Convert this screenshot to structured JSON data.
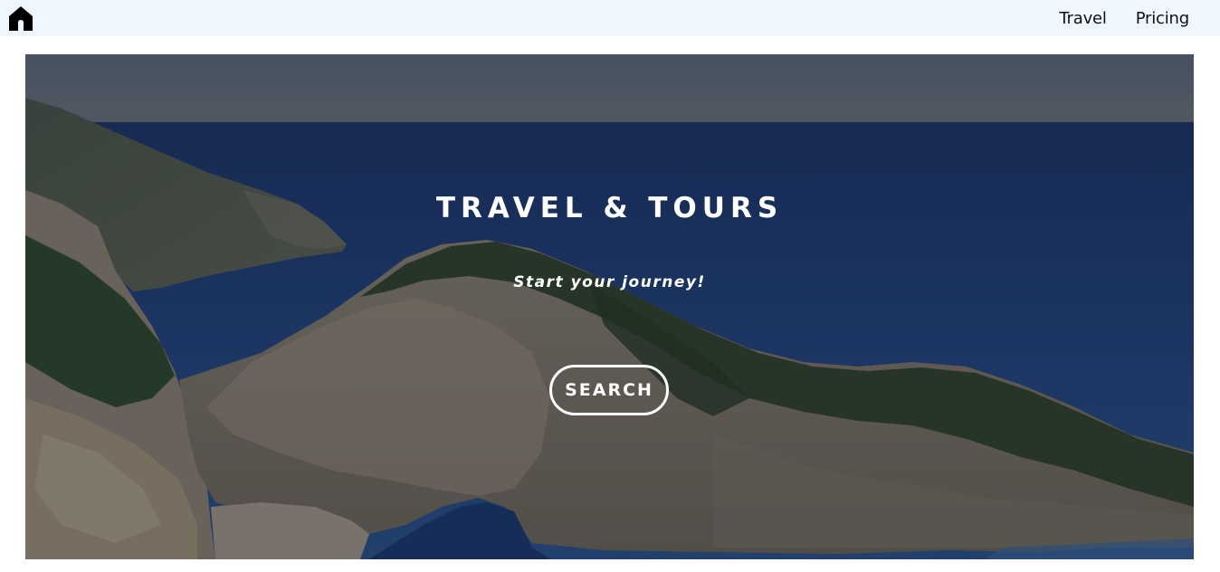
{
  "nav": {
    "home_icon": "home-icon",
    "links": [
      {
        "label": "Travel"
      },
      {
        "label": "Pricing"
      }
    ]
  },
  "hero": {
    "title": "TRAVEL & TOURS",
    "subtitle": "Start your journey!",
    "button_label": "SEARCH"
  },
  "colors": {
    "navbar_bg": "#eef6fe",
    "overlay_text": "#ffffff",
    "sea": "#1f3d73"
  }
}
